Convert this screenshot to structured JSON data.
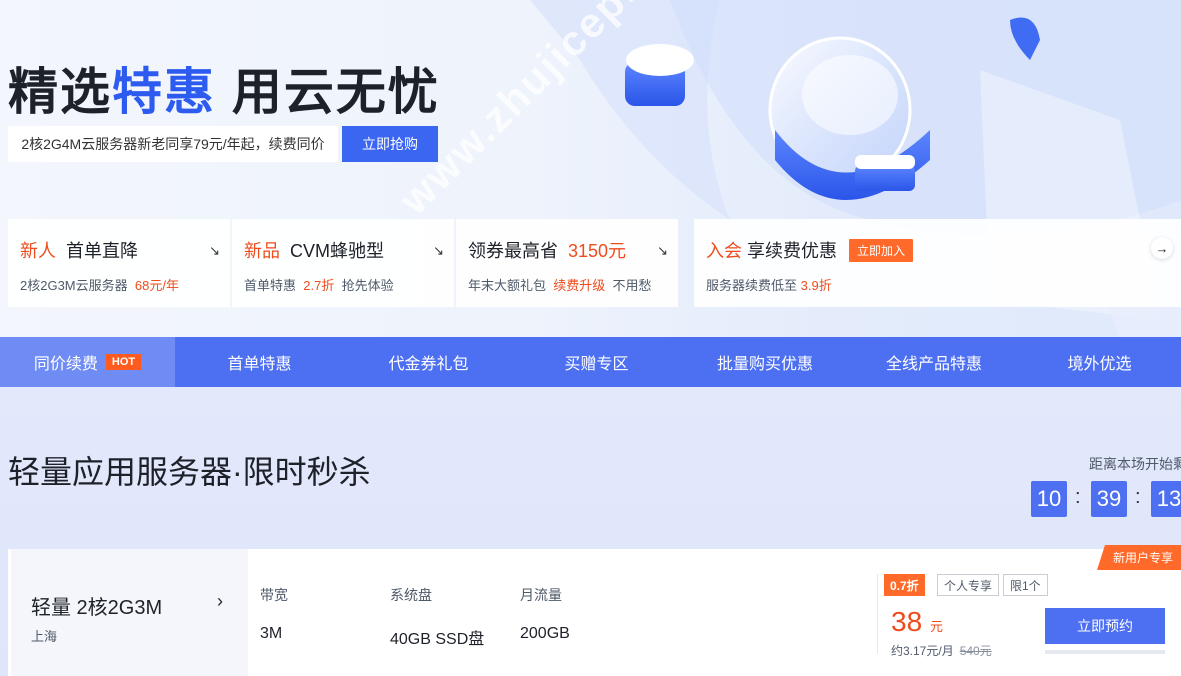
{
  "hero": {
    "title_part1": "精选",
    "title_highlight": "特惠",
    "title_part2": "用云无忧",
    "subtitle": "2核2G4M云服务器新老同享79元/年起，续费同价",
    "cta": "立即抢购",
    "watermark": "www.zhujiceping.com"
  },
  "cards": [
    {
      "tag": "新人",
      "title": "首单直降",
      "desc_prefix": "2核2G3M云服务器",
      "desc_highlight": "68元/年",
      "desc_suffix": ""
    },
    {
      "tag": "新品",
      "title": "CVM蜂驰型",
      "desc_prefix": "首单特惠",
      "desc_highlight": "2.7折",
      "desc_suffix": "抢先体验"
    },
    {
      "tag": "",
      "title": "领券最高省",
      "title_highlight": "3150元",
      "desc_prefix": "年末大额礼包",
      "desc_highlight": "续费升级",
      "desc_suffix": "不用愁"
    },
    {
      "tag": "入会",
      "title": "享续费优惠",
      "badge": "立即加入",
      "desc_prefix": "服务器续费低至",
      "desc_highlight": "3.9折",
      "desc_suffix": ""
    }
  ],
  "nav": {
    "items": [
      "同价续费",
      "首单特惠",
      "代金券礼包",
      "买赠专区",
      "批量购买优惠",
      "全线产品特惠",
      "境外优选"
    ],
    "hot_badge": "HOT"
  },
  "section": {
    "title": "轻量应用服务器·限时秒杀",
    "countdown_label": "距离本场开始剩",
    "countdown": [
      "10",
      "39",
      "13"
    ],
    "separator": ":"
  },
  "product": {
    "badge": "新用户专享",
    "name": "轻量 2核2G3M",
    "region": "上海",
    "specs": [
      {
        "label": "带宽",
        "value": "3M"
      },
      {
        "label": "系统盘",
        "value": "40GB SSD盘"
      },
      {
        "label": "月流量",
        "value": "200GB"
      }
    ],
    "discount": "0.7折",
    "tags": [
      "个人专享",
      "限1个"
    ],
    "price": "38",
    "price_unit": "元",
    "monthly": "约3.17元/月",
    "original": "540元",
    "button": "立即预约"
  },
  "colors": {
    "brand": "#4d6ff2",
    "accent": "#ee4c1c",
    "hot": "#ff5a1f"
  }
}
